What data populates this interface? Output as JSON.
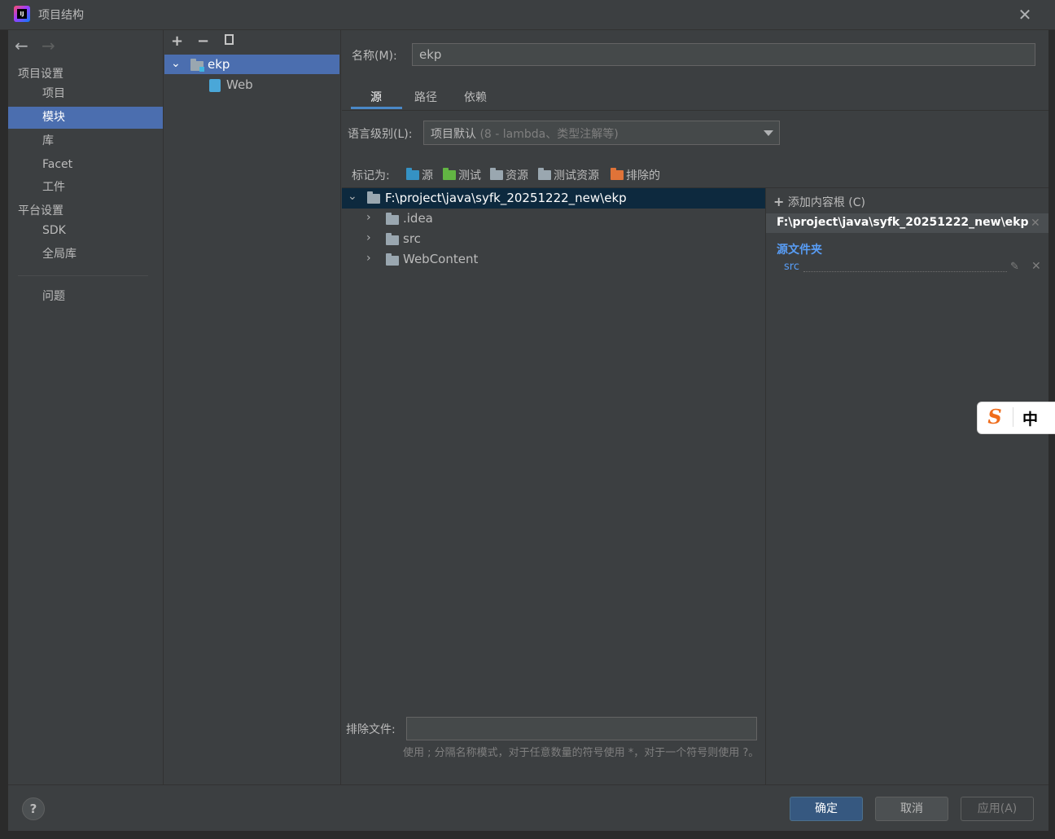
{
  "window": {
    "title": "项目结构"
  },
  "nav": {
    "project_settings_header": "项目设置",
    "items_project": [
      "项目",
      "模块",
      "库",
      "Facet",
      "工件"
    ],
    "platform_settings_header": "平台设置",
    "items_platform": [
      "SDK",
      "全局库"
    ],
    "problems": "问题",
    "selected": "模块"
  },
  "modules": {
    "tree": [
      {
        "name": "ekp",
        "selected": true
      },
      {
        "name": "Web",
        "child": true
      }
    ]
  },
  "module": {
    "name_label": "名称(M):",
    "name_value": "ekp",
    "tabs": [
      "源",
      "路径",
      "依赖"
    ],
    "active_tab": "源",
    "language_level_label": "语言级别(L):",
    "language_level_value": "项目默认",
    "language_level_hint": "(8 - lambda、类型注解等)",
    "mark_as_label": "标记为:",
    "mark_as": [
      {
        "label": "源",
        "color": "#3592c4"
      },
      {
        "label": "测试",
        "color": "#62b543"
      },
      {
        "label": "资源",
        "color": "#9aa7b0"
      },
      {
        "label": "测试资源",
        "color": "#9aa7b0"
      },
      {
        "label": "排除的",
        "color": "#e07338"
      }
    ]
  },
  "file_tree": {
    "root": "F:\\project\\java\\syfk_20251222_new\\ekp",
    "children": [
      ".idea",
      "src",
      "WebContent"
    ]
  },
  "content_roots": {
    "add_label": "添加内容根 (C)",
    "root_path": "F:\\project\\java\\syfk_20251222_new\\ekp",
    "source_folders_header": "源文件夹",
    "source_folders": [
      "src"
    ]
  },
  "exclude": {
    "label": "排除文件:",
    "value": "",
    "hint": "使用 ; 分隔名称模式，对于任意数量的符号使用 *，对于一个符号则使用 ?。"
  },
  "footer": {
    "help": "?",
    "ok": "确定",
    "cancel": "取消",
    "apply": "应用(A)"
  },
  "ime": {
    "lang": "中"
  }
}
